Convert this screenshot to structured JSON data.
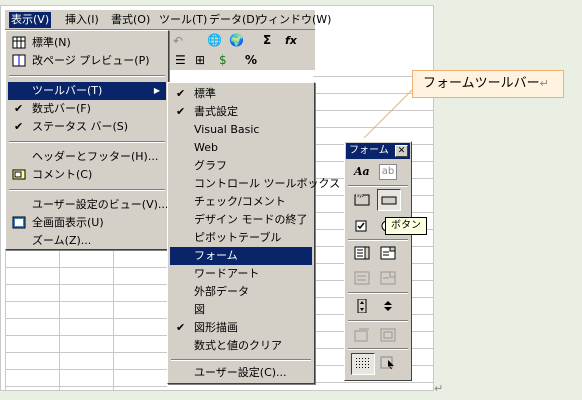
{
  "menubar": {
    "items": [
      "表示(V)",
      "挿入(I)",
      "書式(O)",
      "ツール(T)",
      "データ(D)",
      "ウィンドウ(W)"
    ]
  },
  "view_menu": {
    "items": [
      {
        "label": "標準(N)",
        "icon": "normal-view-icon"
      },
      {
        "label": "改ページ プレビュー(P)",
        "icon": "page-break-preview-icon"
      },
      {
        "label": "ツールバー(T)",
        "submenu": true,
        "selected": true
      },
      {
        "label": "数式バー(F)",
        "checked": true
      },
      {
        "label": "ステータス バー(S)",
        "checked": true
      },
      {
        "label": "ヘッダーとフッター(H)..."
      },
      {
        "label": "コメント(C)",
        "icon": "comment-icon"
      },
      {
        "label": "ユーザー設定のビュー(V)..."
      },
      {
        "label": "全画面表示(U)",
        "icon": "full-screen-icon"
      },
      {
        "label": "ズーム(Z)..."
      }
    ]
  },
  "toolbar_submenu": {
    "items": [
      {
        "label": "標準",
        "checked": true
      },
      {
        "label": "書式設定",
        "checked": true
      },
      {
        "label": "Visual Basic"
      },
      {
        "label": "Web"
      },
      {
        "label": "グラフ"
      },
      {
        "label": "コントロール ツールボックス"
      },
      {
        "label": "チェック/コメント"
      },
      {
        "label": "デザイン モードの終了"
      },
      {
        "label": "ピボットテーブル"
      },
      {
        "label": "フォーム",
        "selected": true
      },
      {
        "label": "ワードアート"
      },
      {
        "label": "外部データ"
      },
      {
        "label": "図"
      },
      {
        "label": "図形描画",
        "checked": true
      },
      {
        "label": "数式と値のクリア"
      },
      {
        "label": "ユーザー設定(C)..."
      }
    ]
  },
  "toolbar": {
    "sigma": "Σ",
    "fx": "fx",
    "percent": "%"
  },
  "forms_toolbar": {
    "title": "フォーム",
    "close": "✕",
    "tooltip": "ボタン",
    "label_glyph": "Aa",
    "editbox_glyph": "ab"
  },
  "callout": {
    "text": "フォームツールバー"
  },
  "para_marks": {
    "callout": "↵",
    "page": "↵"
  },
  "colors": {
    "menu_bg": "#d4d0c8",
    "highlight": "#0a246a",
    "callout_bg": "#fff3e0"
  }
}
